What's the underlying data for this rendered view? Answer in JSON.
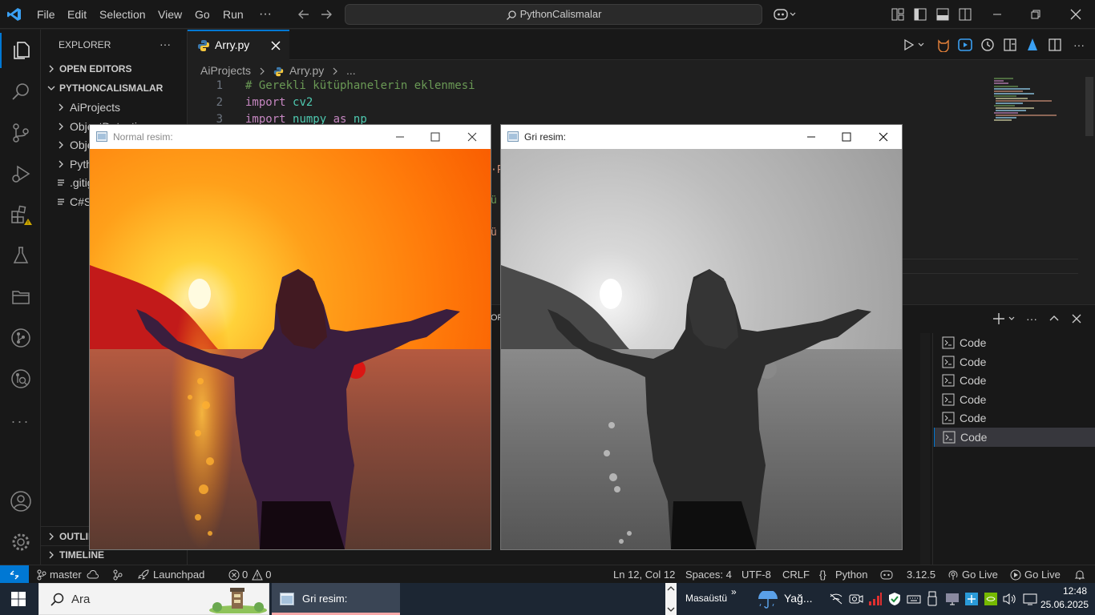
{
  "titlebar": {
    "menus": [
      "File",
      "Edit",
      "Selection",
      "View",
      "Go",
      "Run"
    ],
    "more": "···",
    "search": "PythonCalismalar"
  },
  "sidebar": {
    "title": "EXPLORER",
    "more": "···",
    "open_editors": "OPEN EDITORS",
    "project": "PYTHONCALISMALAR",
    "items": [
      {
        "label": "AiProjects",
        "type": "folder"
      },
      {
        "label": "ObjectDetection",
        "type": "folder"
      },
      {
        "label": "ObjectTracking",
        "type": "folder"
      },
      {
        "label": "PythonProjects",
        "type": "folder"
      },
      {
        "label": ".gitignore",
        "type": "file"
      },
      {
        "label": "C#Sharp",
        "type": "file"
      }
    ],
    "outline": "OUTLINE",
    "timeline": "TIMELINE"
  },
  "editor": {
    "tab_label": "Arry.py",
    "breadcrumb": {
      "folder": "AiProjects",
      "file": "Arry.py",
      "rest": "..."
    },
    "lines": [
      {
        "num": "1",
        "parts": [
          {
            "t": "# Gerekli kütüphanelerin eklenmesi",
            "c": "comment"
          }
        ]
      },
      {
        "num": "2",
        "parts": [
          {
            "t": "import ",
            "c": "keyword"
          },
          {
            "t": "cv2",
            "c": "module"
          }
        ]
      },
      {
        "num": "3",
        "parts": [
          {
            "t": "import ",
            "c": "keyword"
          },
          {
            "t": "numpy ",
            "c": "module"
          },
          {
            "t": "as ",
            "c": "keyword"
          },
          {
            "t": "np",
            "c": "module"
          }
        ]
      }
    ],
    "partial_fragments": [
      "·P",
      "ü",
      "ü"
    ]
  },
  "panel": {
    "terminals": [
      "Code",
      "Code",
      "Code",
      "Code",
      "Code",
      "Code"
    ],
    "active_index": 5,
    "partial_tab": "OR"
  },
  "windows": {
    "normal": {
      "title": "Normal resim:"
    },
    "gray": {
      "title": "Gri resim:"
    }
  },
  "statusbar": {
    "branch": "master",
    "launchpad": "Launchpad",
    "errors": "0",
    "warnings": "0",
    "position": "Ln 12, Col 12",
    "spaces": "Spaces: 4",
    "encoding": "UTF-8",
    "eol": "CRLF",
    "language": "Python",
    "lang_braces": "{}",
    "version": "3.12.5",
    "golive1": "Go Live",
    "golive2": "Go Live"
  },
  "taskbar": {
    "search": "Ara",
    "app_label": "Gri resim:",
    "desktop": "Masaüstü",
    "weather": "Yağ...",
    "time": "12:48",
    "date": "25.06.2025"
  },
  "colors": {
    "accent": "#0078d4",
    "comment": "#6a9955",
    "keyword": "#c586c0",
    "module": "#4ec9b0",
    "warning": "#cca700"
  }
}
